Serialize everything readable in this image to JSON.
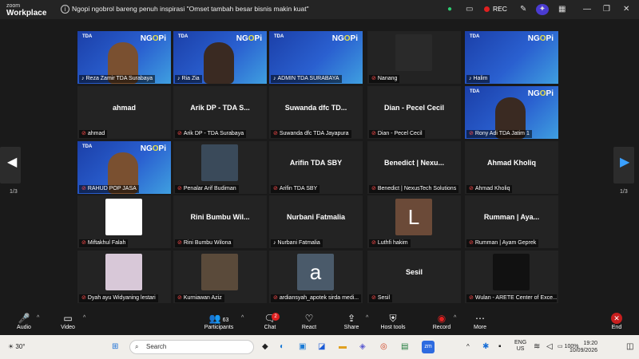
{
  "app": {
    "brand_top": "zoom",
    "brand_bottom": "Workplace",
    "meeting_title": "Ngopi ngobrol bareng penuh inspirasi \"Omset tambah besar bisnis makin kuat\"",
    "rec_label": "REC"
  },
  "pager": {
    "left": "1/3",
    "right": "1/3"
  },
  "tiles": [
    {
      "name": "Reza Zamir TDA Surabaya",
      "type": "video",
      "muted": false
    },
    {
      "name": "Ria Zia",
      "type": "video",
      "muted": false
    },
    {
      "name": "ADMIN TDA SURABAYA",
      "type": "video",
      "muted": false
    },
    {
      "name": "Nanang",
      "type": "pic",
      "muted": true
    },
    {
      "name": "Halim",
      "type": "video",
      "muted": false
    },
    {
      "name": "ahmad",
      "big": "ahmad",
      "type": "text",
      "muted": true
    },
    {
      "name": "Arik DP  - TDA Surabaya",
      "big": "Arik DP  - TDA S...",
      "type": "text",
      "muted": true
    },
    {
      "name": "Suwanda dfc TDA Jayapura",
      "big": "Suwanda dfc TD...",
      "type": "text",
      "muted": true
    },
    {
      "name": "Dian - Pecel Cecil",
      "big": "Dian - Pecel Cecil",
      "type": "text",
      "muted": true
    },
    {
      "name": "Rony Adi TDA Jatim 1",
      "type": "video",
      "muted": true
    },
    {
      "name": "RAHUD POP JASA",
      "type": "video",
      "muted": true
    },
    {
      "name": "Penalar Arif Budiman",
      "type": "pic",
      "muted": true
    },
    {
      "name": "Arifin TDA SBY",
      "big": "Arifin TDA SBY",
      "type": "text",
      "muted": true
    },
    {
      "name": "Benedict | NexusTech Solutions",
      "big": "Benedict | Nexu...",
      "type": "text",
      "muted": true
    },
    {
      "name": "Ahmad Kholiq",
      "big": "Ahmad Kholiq",
      "type": "text",
      "muted": true
    },
    {
      "name": "Miftakhul Falah",
      "type": "pic",
      "muted": true
    },
    {
      "name": "Rini Bumbu Wilona",
      "big": "Rini Bumbu Wil...",
      "type": "text",
      "muted": true
    },
    {
      "name": "Nurbani Fatmalia",
      "big": "Nurbani Fatmalia",
      "type": "text",
      "muted": false
    },
    {
      "name": "Luthfi hakim",
      "letter": "L",
      "type": "letter",
      "muted": true
    },
    {
      "name": "Rumman | Ayam Geprek",
      "big": "Rumman | Aya...",
      "type": "text",
      "muted": true
    },
    {
      "name": "Dyah ayu Widyaning lestari",
      "type": "pic",
      "muted": true
    },
    {
      "name": "Kurniawan Aziz",
      "type": "pic",
      "muted": true
    },
    {
      "name": "ardiansyah_apotek sirda medi...",
      "letter": "a",
      "type": "letter",
      "muted": true
    },
    {
      "name": "Sesil",
      "big": "Sesil",
      "type": "text",
      "muted": true
    },
    {
      "name": "Wulan - ARETE Center of Exce...",
      "type": "pic",
      "muted": true
    }
  ],
  "video_overlay": {
    "tda": "TDA",
    "ngopi_a": "NG",
    "ngopi_b": "O",
    "ngopi_c": "Pi"
  },
  "toolbar": {
    "audio": "Audio",
    "video": "Video",
    "participants": "Participants",
    "participants_count": "63",
    "chat": "Chat",
    "chat_badge": "2",
    "react": "React",
    "share": "Share",
    "host_tools": "Host tools",
    "record": "Record",
    "more": "More",
    "end": "End"
  },
  "taskbar": {
    "weather": "30°",
    "search_placeholder": "Search",
    "lang1": "ENG",
    "lang2": "US",
    "battery": "100%",
    "time": "19:20",
    "date": "10/09/2026"
  },
  "colors": {
    "video_bg": "#2a60d0",
    "rec": "#e02020",
    "muted": "#ff4b4b"
  }
}
